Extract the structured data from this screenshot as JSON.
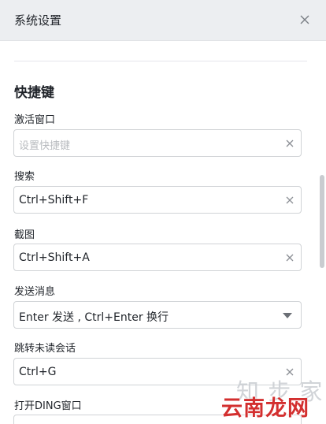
{
  "window": {
    "title": "系统设置"
  },
  "section": {
    "title": "快捷键"
  },
  "shortcuts": [
    {
      "label": "激活窗口",
      "value": "",
      "placeholder": "设置快捷键"
    },
    {
      "label": "搜索",
      "value": "Ctrl+Shift+F"
    },
    {
      "label": "截图",
      "value": "Ctrl+Shift+A"
    },
    {
      "label": "发送消息",
      "value": "Enter 发送 , Ctrl+Enter 换行"
    },
    {
      "label": "跳转未读会话",
      "value": "Ctrl+G"
    },
    {
      "label": "打开DING窗口",
      "value": ""
    }
  ],
  "watermark": {
    "top": "知 步 家",
    "bottom": "云南龙网"
  },
  "icons": {
    "close": "close-icon",
    "clear": "clear-icon",
    "dropdown": "chevron-down-icon"
  },
  "colors": {
    "titlebar_bg": "#eceef1",
    "border": "#d0d3d6",
    "placeholder": "#b8bbbf",
    "watermark_red": "#d32f2f"
  }
}
